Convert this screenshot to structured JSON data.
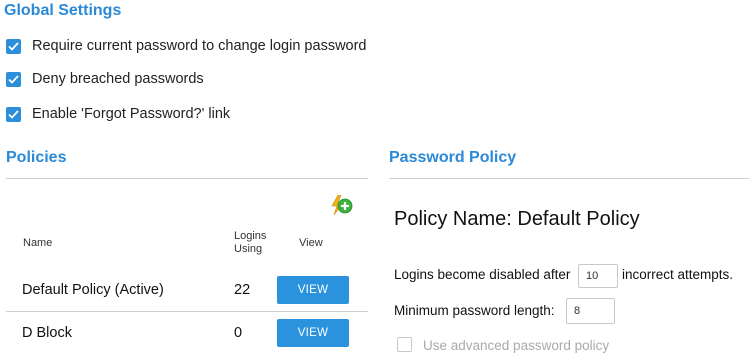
{
  "global_settings": {
    "title": "Global Settings",
    "options": [
      {
        "label": "Require current password to change login password",
        "checked": true
      },
      {
        "label": "Deny breached passwords",
        "checked": true
      },
      {
        "label": "Enable 'Forgot Password?' link",
        "checked": true
      }
    ]
  },
  "policies": {
    "title": "Policies",
    "add_icon": "add-policy-icon",
    "columns": {
      "name": "Name",
      "logins_line1": "Logins",
      "logins_line2": "Using",
      "view": "View"
    },
    "rows": [
      {
        "name": "Default Policy (Active)",
        "logins": "22",
        "view_label": "VIEW"
      },
      {
        "name": "D Block",
        "logins": "0",
        "view_label": "VIEW"
      }
    ]
  },
  "password_policy": {
    "title": "Password Policy",
    "policy_name": "Policy Name: Default Policy",
    "disable_prefix": "Logins become disabled after",
    "disable_value": "10",
    "disable_suffix": "incorrect attempts.",
    "min_length_label": "Minimum password length:",
    "min_length_value": "8",
    "advanced_label": "Use advanced password policy",
    "advanced_checked": false
  },
  "colors": {
    "accent": "#2a8ad8",
    "button": "#2b93dd",
    "divider": "#cfcfcf"
  }
}
